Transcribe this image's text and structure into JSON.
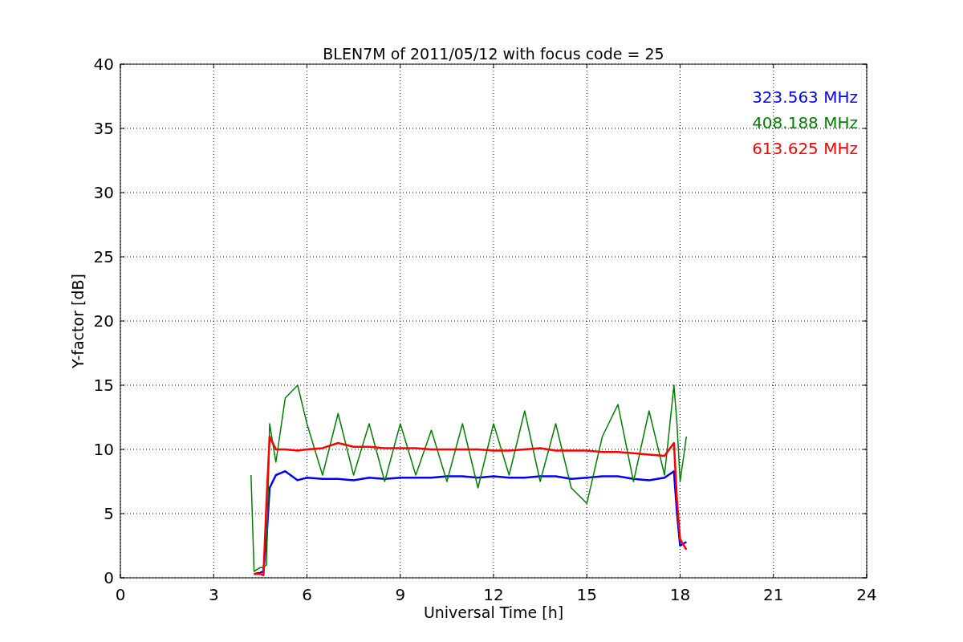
{
  "chart_data": {
    "type": "line",
    "title": "BLEN7M of 2011/05/12 with focus code = 25",
    "xlabel": "Universal Time [h]",
    "ylabel": "Y-factor [dB]",
    "x": [
      4.2,
      4.3,
      4.5,
      4.6,
      4.7,
      4.8,
      5,
      5.3,
      5.7,
      6,
      6.5,
      7,
      7.5,
      8,
      8.5,
      9,
      9.5,
      10,
      10.5,
      11,
      11.5,
      12,
      12.5,
      13,
      13.5,
      14,
      14.5,
      15,
      15.5,
      16,
      16.5,
      17,
      17.5,
      17.8,
      17.9,
      18,
      18.2
    ],
    "series": [
      {
        "name": "323.563 MHz",
        "color": "#0000ff",
        "values": [
          null,
          0.3,
          0.4,
          0.5,
          3,
          7,
          8,
          8.3,
          7.6,
          7.8,
          7.7,
          7.7,
          7.6,
          7.8,
          7.7,
          7.8,
          7.8,
          7.8,
          7.9,
          7.9,
          7.8,
          7.9,
          7.8,
          7.8,
          7.9,
          7.9,
          7.7,
          7.8,
          7.9,
          7.9,
          7.7,
          7.6,
          7.8,
          8.3,
          5,
          2.5,
          2.8
        ]
      },
      {
        "name": "408.188 MHz",
        "color": "#008000",
        "values": [
          8,
          0.5,
          0.8,
          0.8,
          1,
          12,
          9,
          14,
          15,
          12,
          8,
          12.8,
          8,
          12,
          7.5,
          12,
          8,
          11.5,
          7.5,
          12,
          7,
          12,
          8,
          13,
          7.5,
          12,
          7,
          5.8,
          11,
          13.5,
          7.5,
          13,
          8,
          15,
          12,
          7.5,
          11
        ]
      },
      {
        "name": "613.625 MHz",
        "color": "#ff0000",
        "values": [
          null,
          0.3,
          0.3,
          0.2,
          6,
          11,
          10,
          10,
          9.9,
          10,
          10.1,
          10.5,
          10.2,
          10.2,
          10.1,
          10.1,
          10.1,
          10,
          10,
          10,
          10,
          9.9,
          9.9,
          10,
          10.1,
          9.9,
          9.9,
          9.9,
          9.8,
          9.8,
          9.7,
          9.6,
          9.5,
          10.5,
          6,
          3,
          2.2
        ]
      }
    ],
    "grid": true,
    "xlim": [
      0,
      24
    ],
    "ylim": [
      0,
      40
    ],
    "xticks": [
      0,
      3,
      6,
      9,
      12,
      15,
      18,
      21,
      24
    ],
    "yticks": [
      0,
      5,
      10,
      15,
      20,
      25,
      30,
      35,
      40
    ]
  }
}
